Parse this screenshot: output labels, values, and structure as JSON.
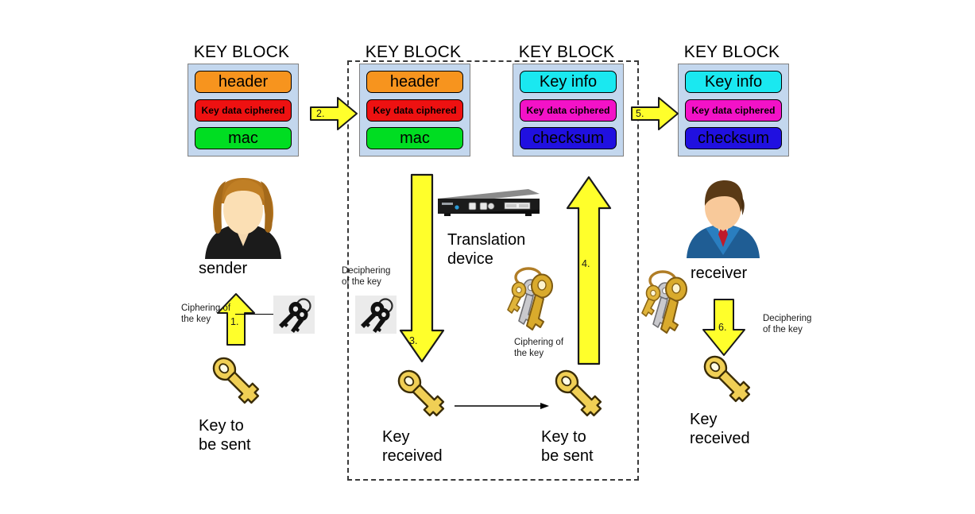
{
  "diagram": {
    "title_text": "KEY BLOCK",
    "colors": {
      "block_bg": "#c3d7ee",
      "header_orange": "#f7941e",
      "ciphered_red": "#ee1111",
      "mac_green": "#00dd22",
      "keyinfo_cyan": "#1ae8f0",
      "ciphered_magenta": "#f312c7",
      "checksum_blue": "#2010e0",
      "arrow_yellow": "#ffff2b",
      "arrow_stroke": "#1a1a1a",
      "zone_dash": "#3a3a3a"
    },
    "key_blocks": [
      {
        "id": "sender-block",
        "title": "KEY BLOCK",
        "rows": [
          {
            "label": "header",
            "style": "big",
            "color": "#f7941e"
          },
          {
            "label": "Key data ciphered",
            "style": "small",
            "color": "#ee1111"
          },
          {
            "label": "mac",
            "style": "big",
            "color": "#00dd22"
          }
        ]
      },
      {
        "id": "translation-in-block",
        "title": "KEY BLOCK",
        "rows": [
          {
            "label": "header",
            "style": "big",
            "color": "#f7941e"
          },
          {
            "label": "Key data ciphered",
            "style": "small",
            "color": "#ee1111"
          },
          {
            "label": "mac",
            "style": "big",
            "color": "#00dd22"
          }
        ]
      },
      {
        "id": "translation-out-block",
        "title": "KEY BLOCK",
        "rows": [
          {
            "label": "Key info",
            "style": "big",
            "color": "#1ae8f0"
          },
          {
            "label": "Key data ciphered",
            "style": "small",
            "color": "#f312c7"
          },
          {
            "label": "checksum",
            "style": "big",
            "color": "#2010e0"
          }
        ]
      },
      {
        "id": "receiver-block",
        "title": "KEY BLOCK",
        "rows": [
          {
            "label": "Key info",
            "style": "big",
            "color": "#1ae8f0"
          },
          {
            "label": "Key data ciphered",
            "style": "small",
            "color": "#f312c7"
          },
          {
            "label": "checksum",
            "style": "big",
            "color": "#2010e0"
          }
        ]
      }
    ],
    "steps": [
      {
        "id": "step-1",
        "number": "1.",
        "direction": "up"
      },
      {
        "id": "step-2",
        "number": "2.",
        "direction": "right"
      },
      {
        "id": "step-3",
        "number": "3.",
        "direction": "down"
      },
      {
        "id": "step-4",
        "number": "4.",
        "direction": "up"
      },
      {
        "id": "step-5",
        "number": "5.",
        "direction": "right"
      },
      {
        "id": "step-6",
        "number": "6.",
        "direction": "down"
      }
    ],
    "actors": {
      "sender_label": "sender",
      "receiver_label": "receiver",
      "device_label": "Translation\ndevice"
    },
    "notes": {
      "cipher_sender": "Ciphering of\nthe key",
      "decipher_device": "Deciphering\nof the key",
      "cipher_device": "Ciphering of\nthe key",
      "decipher_receiver": "Deciphering\nof the key"
    },
    "key_labels": {
      "sender_key": "Key to\nbe sent",
      "device_key_received": "Key\nreceived",
      "device_key_to_send": "Key to\nbe sent",
      "receiver_key": "Key\nreceived"
    }
  }
}
